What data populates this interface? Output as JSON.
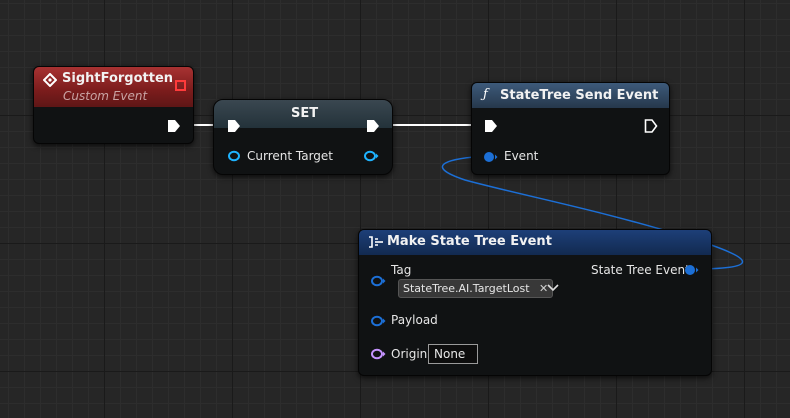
{
  "nodes": {
    "sight_forgotten": {
      "title": "SightForgotten",
      "subtitle": "Custom Event"
    },
    "set": {
      "title": "SET",
      "input_label": "Current Target"
    },
    "send_event": {
      "title": "StateTree Send Event",
      "title_icon": "function-icon",
      "input_label": "Event"
    },
    "make_event": {
      "title": "Make State Tree Event",
      "title_icon": "make-struct-icon",
      "tag_label": "Tag",
      "tag_value": "StateTree.AI.TargetLost",
      "output_label": "State Tree Event",
      "payload_label": "Payload",
      "origin_label": "Origin",
      "origin_value": "None"
    }
  },
  "colors": {
    "exec_wire": "#ffffff",
    "struct_pin": "#1c6fd6",
    "object_pin": "#1eb3ff",
    "name_pin": "#c593ff",
    "event_header": "#8d2222",
    "function_header": "#2f4a66",
    "make_header": "#16305c"
  }
}
